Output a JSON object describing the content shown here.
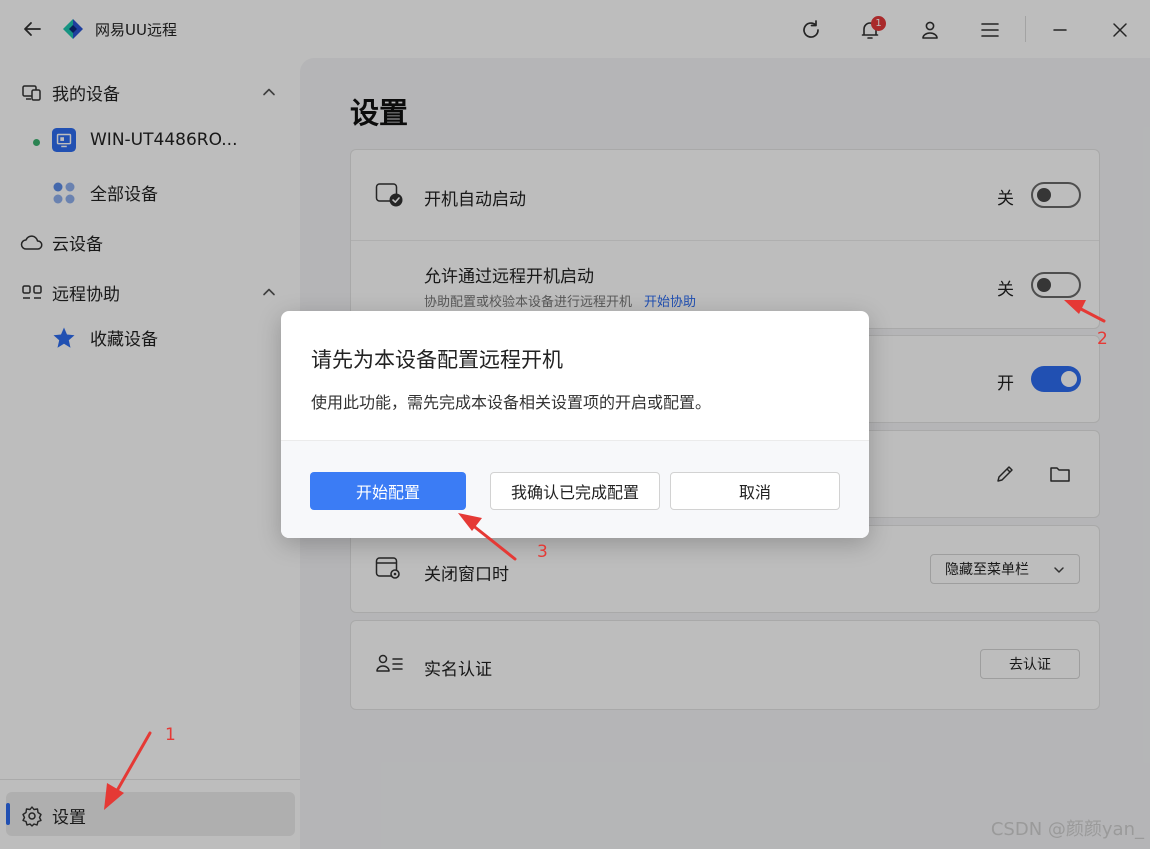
{
  "app": {
    "title": "网易UU远程",
    "notification_count": "1"
  },
  "sidebar": {
    "my_devices": "我的设备",
    "device_name": "WIN-UT4486RO...",
    "all_devices": "全部设备",
    "cloud_devices": "云设备",
    "remote_assist": "远程协助",
    "favorites": "收藏设备",
    "settings": "设置"
  },
  "main": {
    "page_title": "设置",
    "rows": {
      "autostart": {
        "label": "开机自动启动",
        "state": "关"
      },
      "remote_boot": {
        "label": "允许通过远程开机启动",
        "sub": "协助配置或校验本设备进行远程开机",
        "link": "开始协助",
        "state": "关"
      },
      "third": {
        "state": "开"
      },
      "close_window": {
        "label": "关闭窗口时",
        "select_value": "隐藏至菜单栏"
      },
      "real_name": {
        "label": "实名认证",
        "button": "去认证"
      }
    }
  },
  "dialog": {
    "title": "请先为本设备配置远程开机",
    "message": "使用此功能，需先完成本设备相关设置项的开启或配置。",
    "primary_button": "开始配置",
    "confirm_button": "我确认已完成配置",
    "cancel_button": "取消"
  },
  "annotations": {
    "one": "1",
    "two": "2",
    "three": "3"
  },
  "watermark": "CSDN @颜颜yan_",
  "colors": {
    "accent": "#2d6cf0",
    "online": "#3cb371",
    "annotation": "#e53935"
  }
}
